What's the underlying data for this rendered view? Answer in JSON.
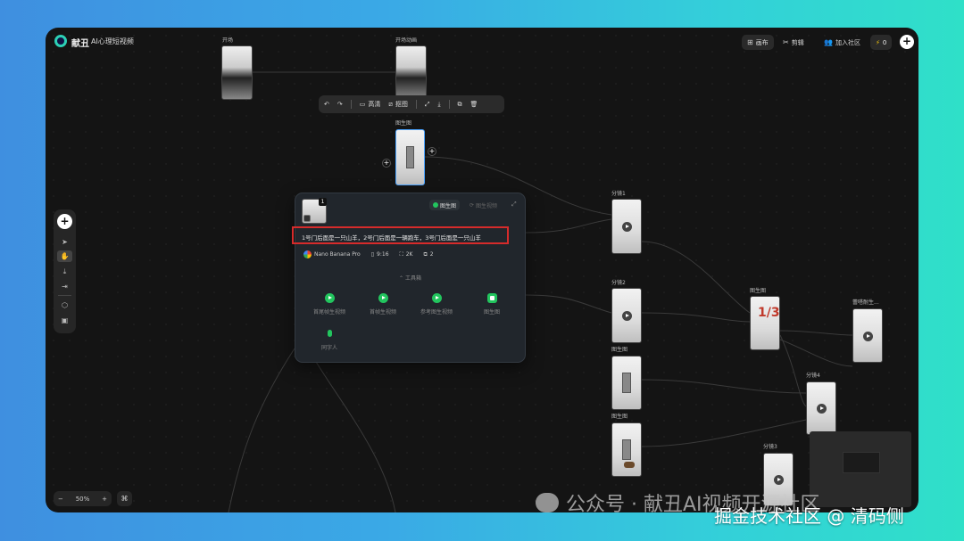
{
  "app": {
    "brand": "献丑",
    "project_title": "AI心理短视频",
    "tabs": [
      {
        "label": "画布",
        "icon": "canvas-icon",
        "active": true
      },
      {
        "label": "剪辑",
        "icon": "scissors-icon",
        "active": false
      }
    ],
    "join_community": "加入社区",
    "credits": "0",
    "accent": "#2dd0b5"
  },
  "canvas_nodes": {
    "n1_label": "开场",
    "n2_label": "开场动画",
    "n3_label": "图生图",
    "n4_label": "分镜1",
    "n5_label": "分镜2",
    "n6_label": "图生图",
    "n7_label": "图生图",
    "n8_label": "图生图",
    "n9_label": "蕾嗒耐生...",
    "n10_label": "分镜4",
    "n11_label": "分镜3",
    "thumb_13": "1/3"
  },
  "image_toolbar": {
    "undo": "↶",
    "redo": "↷",
    "hd_label": "高清",
    "crop_label": "抠图"
  },
  "panel": {
    "ref_count": "1",
    "mode_active": "图生图",
    "mode_inactive": "图生视频",
    "prompt": "1号门后面是一只山羊，2号门后面是一辆跑车，3号门后面是一只山羊",
    "model": "Nano Banana Pro",
    "ratio": "9:16",
    "resolution": "2K",
    "count": "2",
    "tools_title": "工具箱",
    "tools": [
      {
        "label": "首尾帧生视频"
      },
      {
        "label": "首帧生视频"
      },
      {
        "label": "参考图生视频"
      },
      {
        "label": "图生图"
      },
      {
        "label": "同字人"
      }
    ],
    "highlight_color": "#d62b2b"
  },
  "zoom": {
    "minus": "−",
    "value": "50%",
    "plus": "+"
  },
  "watermarks": {
    "wechat": "公众号 · 献丑AI视频开源社区",
    "juejin": "掘金技术社区 @ 清码侧"
  }
}
